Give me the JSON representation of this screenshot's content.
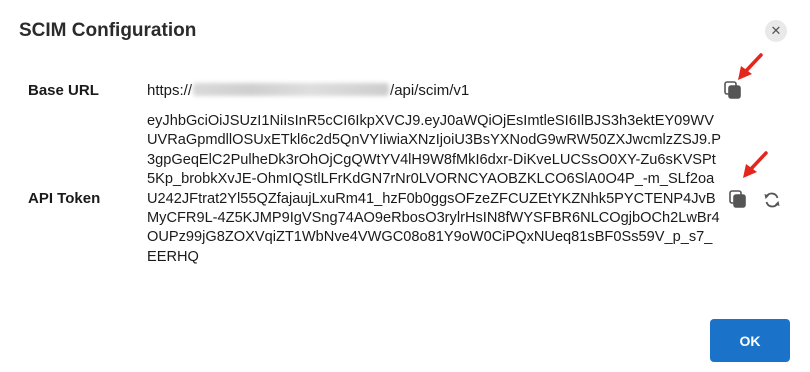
{
  "dialog": {
    "title": "SCIM Configuration",
    "close_icon": "close-icon",
    "ok_label": "OK"
  },
  "base_url": {
    "label": "Base URL",
    "prefix": "https://",
    "suffix": "/api/scim/v1",
    "copy_icon": "copy-icon"
  },
  "api_token": {
    "label": "API Token",
    "value": "eyJhbGciOiJSUzI1NiIsInR5cCI6IkpXVCJ9.eyJ0aWQiOjEsImtleSI6IlBJS3h3ektEY09WVUVRaGpmdllOSUxETkl6c2d5QnVYIiwiaXNzIjoiU3BsYXNodG9wRW50ZXJwcmlzZSJ9.P3gpGeqElC2PulheDk3rOhOjCgQWtYV4lH9W8fMkI6dxr-DiKveLUCSsO0XY-Zu6sKVSPt5Kp_brobkXvJE-OhmIQStlLFrKdGN7rNr0LVORNCYAOBZKLCO6SlA0O4P_-m_SLf2oaU242JFtrat2Yl55QZfajaujLxuRm41_hzF0b0ggsOFzeZFCUZEtYKZNhk5PYCTENP4JvBMyCFR9L-4Z5KJMP9IgVSng74AO9eRbosO3rylrHsIN8fWYSFBR6NLCOgjbOCh2LwBr4OUPz99jG8ZOXVqiZT1WbNve4VWGC08o81Y9oW0CiPQxNUeq81sBF0Ss59V_p_s7_EERHQ",
    "copy_icon": "copy-icon",
    "refresh_icon": "refresh-icon"
  },
  "colors": {
    "ok_button": "#1a73c9",
    "annotation_arrow": "#e5261f"
  }
}
